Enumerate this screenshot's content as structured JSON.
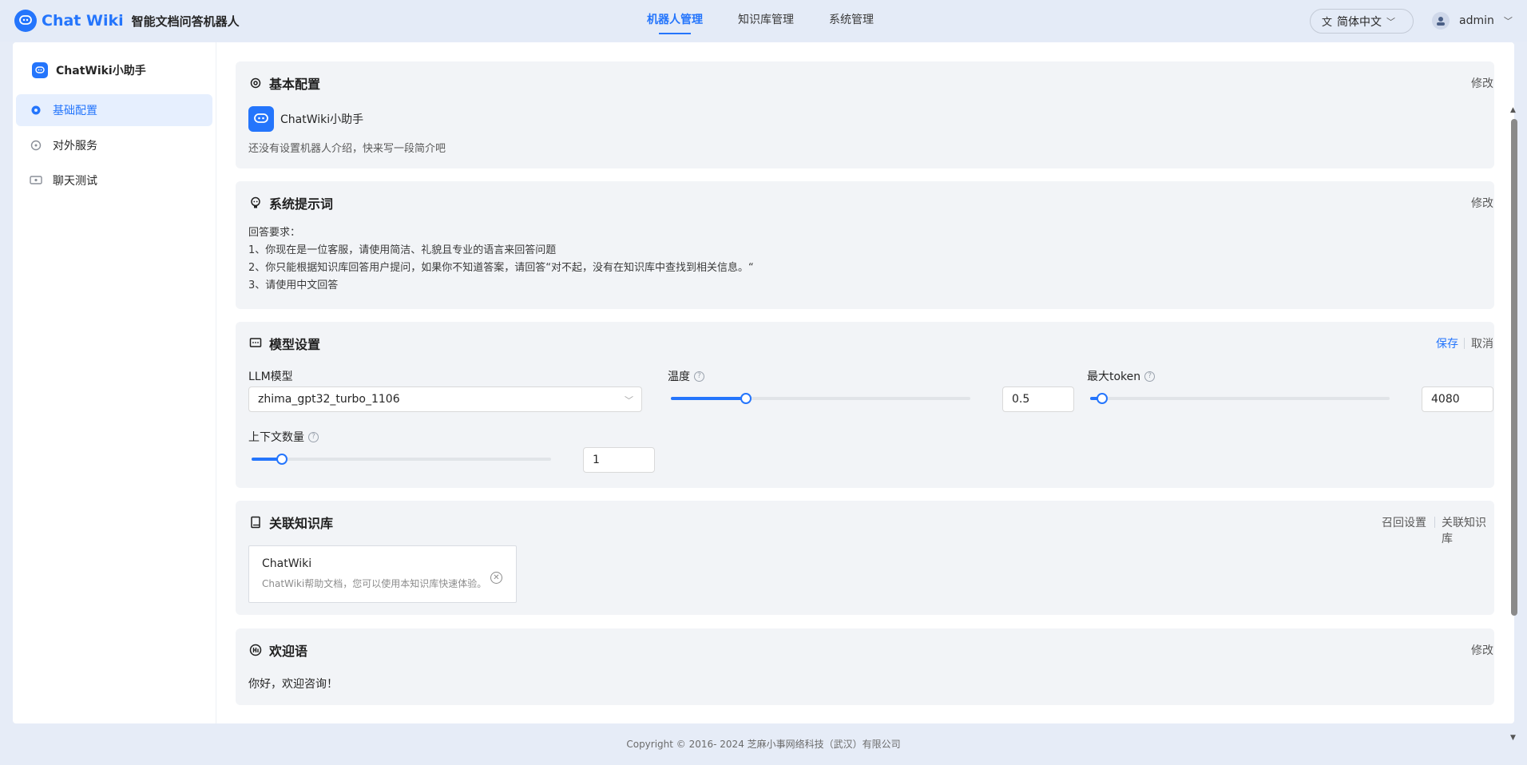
{
  "header": {
    "logo_text": "Chat Wiki",
    "subtitle": "智能文档问答机器人",
    "nav": [
      {
        "label": "机器人管理",
        "active": true
      },
      {
        "label": "知识库管理",
        "active": false
      },
      {
        "label": "系统管理",
        "active": false
      }
    ],
    "language": "简体中文",
    "user": "admin"
  },
  "sidebar": {
    "bot_name": "ChatWiki小助手",
    "menu": [
      {
        "label": "基础配置",
        "icon": "gear-icon",
        "active": true
      },
      {
        "label": "对外服务",
        "icon": "service-icon",
        "active": false
      },
      {
        "label": "聊天测试",
        "icon": "chat-test-icon",
        "active": false
      }
    ]
  },
  "basic": {
    "title": "基本配置",
    "edit": "修改",
    "bot_name": "ChatWiki小助手",
    "intro": "还没有设置机器人介绍，快来写一段简介吧"
  },
  "prompt": {
    "title": "系统提示词",
    "edit": "修改",
    "lines": [
      "回答要求：",
      "1、你现在是一位客服，请使用简洁、礼貌且专业的语言来回答问题",
      "2、你只能根据知识库回答用户提问，如果你不知道答案，请回答“对不起，没有在知识库中查找到相关信息。“",
      "3、请使用中文回答"
    ]
  },
  "model": {
    "title": "模型设置",
    "save": "保存",
    "cancel": "取消",
    "llm_label": "LLM模型",
    "llm_value": "zhima_gpt32_turbo_1106",
    "temp_label": "温度",
    "temp_value": "0.5",
    "temp_fraction": 0.25,
    "token_label": "最大token",
    "token_value": "4080",
    "token_fraction": 0.04,
    "context_label": "上下文数量",
    "context_value": "1",
    "context_fraction": 0.1
  },
  "knowledge": {
    "title": "关联知识库",
    "recall": "召回设置",
    "link": "关联知识库",
    "item_name": "ChatWiki",
    "item_desc": "ChatWiki帮助文档，您可以使用本知识库快速体验。"
  },
  "welcome": {
    "title": "欢迎语",
    "edit": "修改",
    "text": "你好，欢迎咨询！"
  },
  "footer": "Copyright © 2016- 2024 芝麻小事网络科技（武汉）有限公司",
  "colors": {
    "accent": "#2475fc",
    "card_bg": "#f2f4f7",
    "page_bg": "#e6ecf7"
  }
}
